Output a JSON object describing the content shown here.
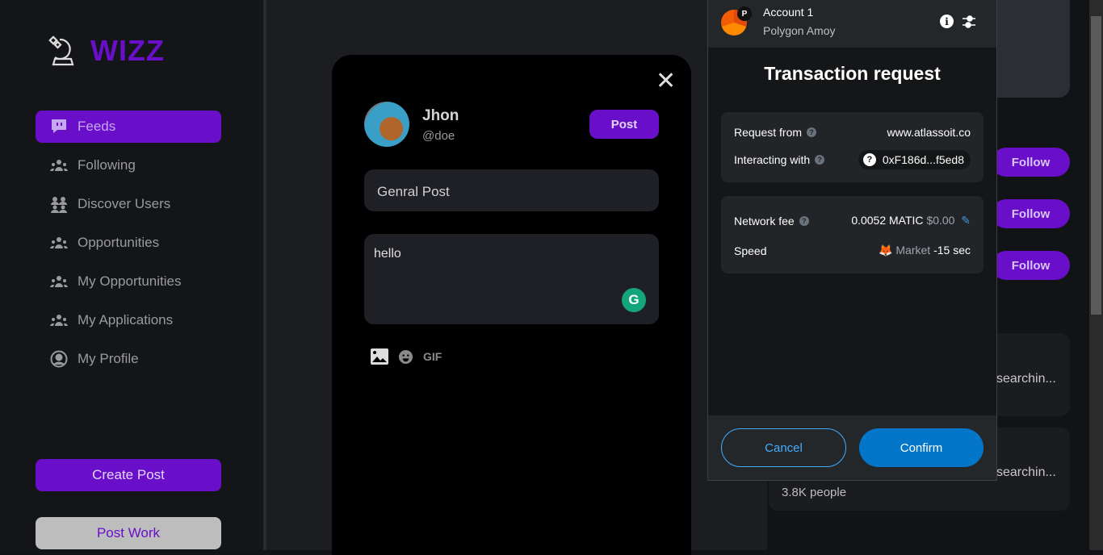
{
  "brand": {
    "name": "WIZZ",
    "accent": "#6a0fc9"
  },
  "sidebar": {
    "items": [
      {
        "label": "Feeds",
        "icon": "chat-bubble-icon",
        "active": true
      },
      {
        "label": "Following",
        "icon": "users-icon"
      },
      {
        "label": "Discover Users",
        "icon": "users-discover-icon"
      },
      {
        "label": "Opportunities",
        "icon": "users-icon"
      },
      {
        "label": "My Opportunities",
        "icon": "users-icon"
      },
      {
        "label": "My Applications",
        "icon": "users-icon"
      },
      {
        "label": "My Profile",
        "icon": "user-circle-icon"
      }
    ],
    "create_post": "Create Post",
    "post_work": "Post Work"
  },
  "composer": {
    "user_name": "Jhon",
    "user_handle": "@doe",
    "post_label": "Post",
    "post_type": "Genral Post",
    "content": "hello",
    "gif_label": "GIF"
  },
  "right": {
    "follow_label": "Follow",
    "snippet": "searchin...",
    "people": "3.8K people"
  },
  "metamask": {
    "account": "Account 1",
    "network_badge": "P",
    "network": "Polygon Amoy",
    "title": "Transaction request",
    "request_from_label": "Request from",
    "request_from": "www.atlassoit.co",
    "interacting_label": "Interacting with",
    "interacting": "0xF186d...f5ed8",
    "fee_label": "Network fee",
    "fee": "0.0052 MATIC",
    "fee_fiat": "$0.00",
    "speed_label": "Speed",
    "speed": "Market",
    "speed_time": "-15 sec",
    "cancel": "Cancel",
    "confirm": "Confirm",
    "confirm_color": "#0376c9"
  }
}
